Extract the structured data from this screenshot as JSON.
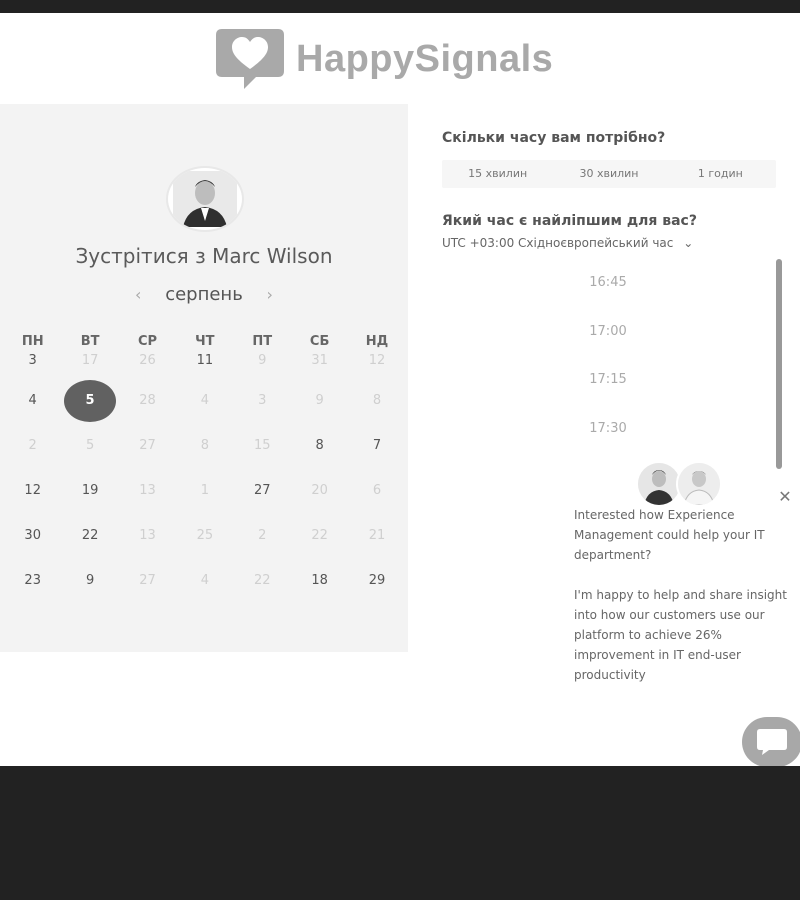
{
  "brand": {
    "name": "HappySignals"
  },
  "calendar": {
    "title": "Зустрітися з Marc Wilson",
    "month": "серпень",
    "prev_label": "‹",
    "next_label": "›",
    "weekdays": [
      "ПН",
      "ВТ",
      "СР",
      "ЧТ",
      "ПТ",
      "СБ",
      "НД"
    ],
    "weeks": [
      [
        {
          "d": "3",
          "muted": false
        },
        {
          "d": "17",
          "muted": true
        },
        {
          "d": "26",
          "muted": true
        },
        {
          "d": "11",
          "muted": false
        },
        {
          "d": "9",
          "muted": true
        },
        {
          "d": "31",
          "muted": true
        },
        {
          "d": "12",
          "muted": true
        }
      ],
      [
        {
          "d": "4",
          "muted": false
        },
        {
          "d": "5",
          "muted": false,
          "selected": true
        },
        {
          "d": "28",
          "muted": true
        },
        {
          "d": "4",
          "muted": true
        },
        {
          "d": "3",
          "muted": true
        },
        {
          "d": "9",
          "muted": true
        },
        {
          "d": "8",
          "muted": true
        }
      ],
      [
        {
          "d": "2",
          "muted": true
        },
        {
          "d": "5",
          "muted": true
        },
        {
          "d": "27",
          "muted": true
        },
        {
          "d": "8",
          "muted": true
        },
        {
          "d": "15",
          "muted": true
        },
        {
          "d": "8",
          "muted": false
        },
        {
          "d": "7",
          "muted": false
        }
      ],
      [
        {
          "d": "12",
          "muted": false
        },
        {
          "d": "19",
          "muted": false
        },
        {
          "d": "13",
          "muted": true
        },
        {
          "d": "1",
          "muted": true
        },
        {
          "d": "27",
          "muted": false
        },
        {
          "d": "20",
          "muted": true
        },
        {
          "d": "6",
          "muted": true
        }
      ],
      [
        {
          "d": "30",
          "muted": false
        },
        {
          "d": "22",
          "muted": false
        },
        {
          "d": "13",
          "muted": true
        },
        {
          "d": "25",
          "muted": true
        },
        {
          "d": "2",
          "muted": true
        },
        {
          "d": "22",
          "muted": true
        },
        {
          "d": "21",
          "muted": true
        }
      ],
      [
        {
          "d": "23",
          "muted": false
        },
        {
          "d": "9",
          "muted": false
        },
        {
          "d": "27",
          "muted": true
        },
        {
          "d": "4",
          "muted": true
        },
        {
          "d": "22",
          "muted": true
        },
        {
          "d": "18",
          "muted": false
        },
        {
          "d": "29",
          "muted": false
        }
      ]
    ]
  },
  "booking": {
    "duration_question": "Скільки часу вам потрібно?",
    "durations": [
      "15 хвилин",
      "30 хвилин",
      "1 годин"
    ],
    "time_question": "Який час є найліпшим для вас?",
    "timezone": "UTC +03:00 Східноєвропейський час",
    "timezone_caret": "⌄",
    "slots": [
      "16:45",
      "17:00",
      "17:15",
      "17:30"
    ]
  },
  "chat": {
    "message_1": "Interested how Experience Management could help your IT department?",
    "message_2": "I'm happy to help and share insight into how our customers use our platform to achieve 26% improvement in IT end-user productivity",
    "close_label": "✕"
  },
  "colors": {
    "selected_day": "#616161",
    "logo": "#a9a9a9",
    "panel_bg": "#f3f3f3"
  }
}
